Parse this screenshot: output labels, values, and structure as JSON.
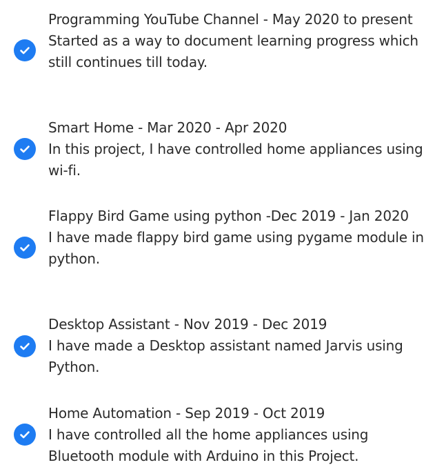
{
  "projects": [
    {
      "title": "Programming YouTube Channel - May 2020 to present",
      "description": "Started as a way to document learning progress which still continues till today.",
      "icon": "check-circle-icon"
    },
    {
      "title": "Smart Home - Mar 2020 - Apr 2020",
      "description": "In this project, I have controlled home appliances using wi-fi.",
      "icon": "check-circle-icon"
    },
    {
      "title": "Flappy Bird Game using python  -Dec 2019 - Jan 2020",
      "description": "I have made flappy bird game using pygame module in python.",
      "icon": "check-circle-icon"
    },
    {
      "title": "Desktop Assistant - Nov 2019 - Dec 2019",
      "description": "I have made a Desktop assistant named Jarvis using Python.",
      "icon": "check-circle-icon"
    },
    {
      "title": "Home Automation - Sep 2019 - Oct 2019",
      "description": "I have controlled all the home appliances using Bluetooth module with Arduino in this Project.",
      "icon": "check-circle-icon"
    }
  ],
  "colors": {
    "check_bg": "#1e7cf2",
    "text": "#2b2b2b"
  }
}
